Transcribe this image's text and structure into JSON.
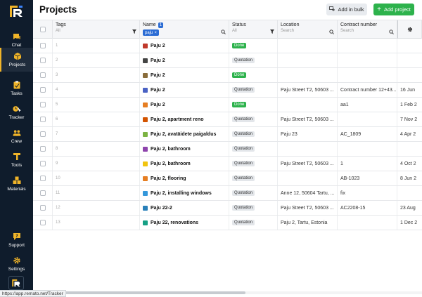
{
  "app": {
    "status_url": "https://app.remato.net/Tracker"
  },
  "colors": {
    "sidebar": "#0f1c2c",
    "accent": "#f0b429",
    "primary": "#2db24c",
    "chip": "#2b6cd4"
  },
  "sidebar": {
    "items": [
      {
        "label": "Chat",
        "icon": "chat-icon"
      },
      {
        "label": "Projects",
        "icon": "projects-icon"
      },
      {
        "label": "Tasks",
        "icon": "tasks-icon"
      },
      {
        "label": "Tracker",
        "icon": "tracker-icon"
      },
      {
        "label": "Crew",
        "icon": "crew-icon"
      },
      {
        "label": "Tools",
        "icon": "tools-icon"
      },
      {
        "label": "Materials",
        "icon": "materials-icon"
      },
      {
        "label": "Support",
        "icon": "support-icon"
      },
      {
        "label": "Settings",
        "icon": "settings-icon"
      }
    ]
  },
  "header": {
    "title": "Projects",
    "bulk_label": "Add in bulk",
    "add_label": "Add project"
  },
  "table": {
    "columns": {
      "tags": {
        "label": "Tags",
        "sub": "All"
      },
      "name": {
        "label": "Name",
        "count": "1",
        "chip": "paju"
      },
      "status": {
        "label": "Status",
        "sub": "All"
      },
      "location": {
        "label": "Location",
        "placeholder": "Search"
      },
      "contract": {
        "label": "Contract number",
        "placeholder": "Search"
      }
    },
    "rows": [
      {
        "idx": "1",
        "name": "Paju 2",
        "status": "Done",
        "location": "",
        "contract": "",
        "date": ""
      },
      {
        "idx": "2",
        "name": "Paju 2",
        "status": "Quotation",
        "location": "",
        "contract": "",
        "date": ""
      },
      {
        "idx": "3",
        "name": "Paju 2",
        "status": "Done",
        "location": "",
        "contract": "",
        "date": ""
      },
      {
        "idx": "4",
        "name": "Paju 2",
        "status": "Quotation",
        "location": "Paju Street T2, 50603 ...",
        "contract": "Contract number 12+43...",
        "date": "16 Jun"
      },
      {
        "idx": "5",
        "name": "Paju 2",
        "status": "Done",
        "location": "",
        "contract": "aa1",
        "date": "1 Feb 2"
      },
      {
        "idx": "6",
        "name": "Paju 2, apartment reno",
        "status": "Quotation",
        "location": "Paju Street T2, 50603 ...",
        "contract": "",
        "date": "7 Nov 2"
      },
      {
        "idx": "7",
        "name": "Paju 2, avatäidete paigaldus",
        "status": "Quotation",
        "location": "Paju 23",
        "contract": "AC_1809",
        "date": "4 Apr 2"
      },
      {
        "idx": "8",
        "name": "Paju 2, bathroom",
        "status": "Quotation",
        "location": "",
        "contract": "",
        "date": ""
      },
      {
        "idx": "9",
        "name": "Paju 2, bathroom",
        "status": "Quotation",
        "location": "Paju Street T2, 50603 ...",
        "contract": "1",
        "date": "4 Oct 2"
      },
      {
        "idx": "10",
        "name": "Paju 2, flooring",
        "status": "Quotation",
        "location": "",
        "contract": "AB-1023",
        "date": "8 Jun 2"
      },
      {
        "idx": "11",
        "name": "Paju 2, installing windows",
        "status": "Quotation",
        "location": "Anne 12, 50604 Tartu, ...",
        "contract": "fix",
        "date": ""
      },
      {
        "idx": "12",
        "name": "Paju 22-2",
        "status": "Quotation",
        "location": "Paju Street T2, 50603 ...",
        "contract": "AC2208-15",
        "date": "23 Aug"
      },
      {
        "idx": "13",
        "name": "Paju 22, renovations",
        "status": "Quotation",
        "location": "Paju 2, Tartu, Estonia",
        "contract": "",
        "date": "1 Dec 2"
      }
    ],
    "cube_colors": [
      "#c0392b",
      "#444444",
      "#8a6d3b",
      "#4a62c4",
      "#e67e22",
      "#d35400",
      "#7cb342",
      "#8e44ad",
      "#f1c40f",
      "#e67e22",
      "#3498db",
      "#2980b9",
      "#16a085"
    ]
  }
}
